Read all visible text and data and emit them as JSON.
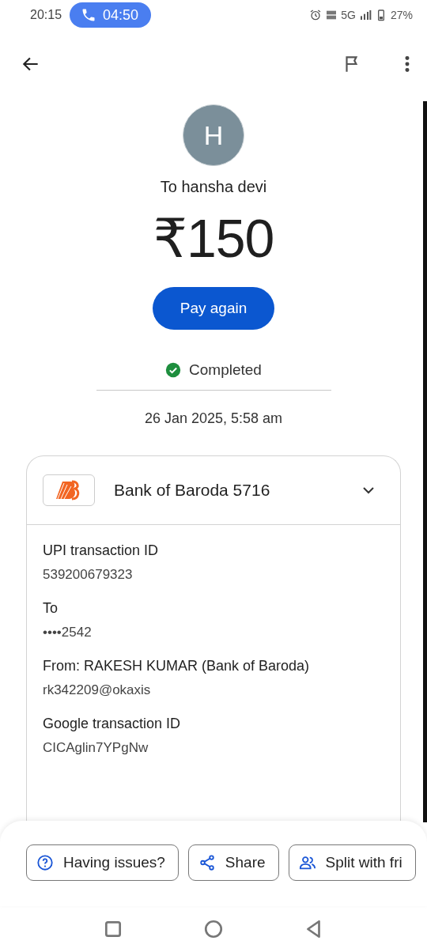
{
  "status_bar": {
    "time": "20:15",
    "call_timer": "04:50",
    "network": "5G",
    "battery": "27%"
  },
  "recipient": {
    "initial": "H",
    "name": "To hansha devi"
  },
  "amount": "₹150",
  "pay_button": "Pay again",
  "status": {
    "label": "Completed",
    "completed": true
  },
  "date": "26 Jan 2025, 5:58 am",
  "account": {
    "bank": "Bank of Baroda 5716",
    "expanded": false
  },
  "details": [
    {
      "label": "UPI transaction ID",
      "value": "539200679323"
    },
    {
      "label": "To",
      "value": "••••2542"
    },
    {
      "label": "From: RAKESH KUMAR (Bank of Baroda)",
      "value": "rk342209@okaxis"
    },
    {
      "label": "Google transaction ID",
      "value": "CICAglin7YPgNw"
    }
  ],
  "actions": [
    {
      "kind": "help",
      "label": "Having issues?"
    },
    {
      "kind": "share",
      "label": "Share"
    },
    {
      "kind": "split",
      "label": "Split with fri"
    }
  ]
}
